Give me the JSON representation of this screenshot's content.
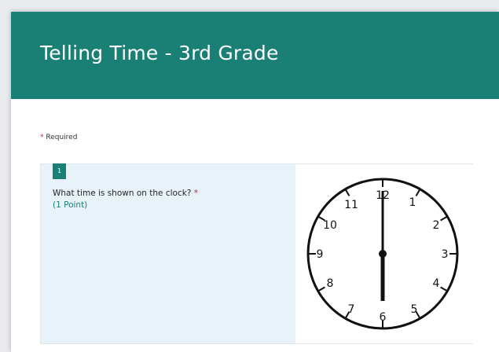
{
  "form": {
    "title": "Telling Time - 3rd Grade",
    "required_star": "*",
    "required_label": "Required"
  },
  "question": {
    "number": "1",
    "text": "What time is shown on the clock?",
    "required_star": "*",
    "points": "(1 Point)"
  },
  "clock": {
    "numbers": [
      "12",
      "1",
      "2",
      "3",
      "4",
      "5",
      "6",
      "7",
      "8",
      "9",
      "10",
      "11"
    ],
    "hour": 6,
    "minute": 0
  },
  "colors": {
    "header": "#1a7f74",
    "required": "#c4262e",
    "card_background": "#e8f2f9"
  }
}
